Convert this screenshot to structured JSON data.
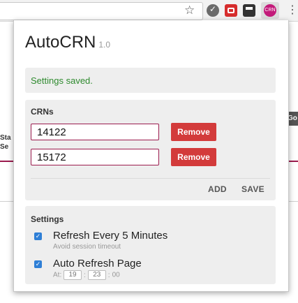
{
  "popup": {
    "title": "AutoCRN",
    "version": "1.0",
    "status_message": "Settings saved.",
    "crns": {
      "heading": "CRNs",
      "entries": [
        {
          "value": "14122",
          "remove_label": "Remove"
        },
        {
          "value": "15172",
          "remove_label": "Remove"
        }
      ],
      "add_label": "ADD",
      "save_label": "SAVE"
    },
    "settings": {
      "heading": "Settings",
      "refresh": {
        "label": "Refresh Every 5 Minutes",
        "hint": "Avoid session timeout",
        "checked": true
      },
      "auto_refresh": {
        "label": "Auto Refresh Page",
        "at_label": "At:",
        "hour": "19",
        "minute": "23",
        "second": "00",
        "checked": true
      }
    }
  },
  "toolbar": {
    "extension_badge": "CRN",
    "icons": [
      "star-icon",
      "checkmark-extension-icon",
      "red-extension-icon",
      "dark-extension-icon",
      "autocrn-extension-icon",
      "menu-dots-icon"
    ]
  },
  "background_page": {
    "left_fragment": "Sta\nSe",
    "right_fragment": "Go"
  },
  "colors": {
    "accent": "#9b1b4e",
    "remove_button": "#d33b3b",
    "success_text": "#2e8a2e",
    "checkbox": "#2f7fd6"
  }
}
